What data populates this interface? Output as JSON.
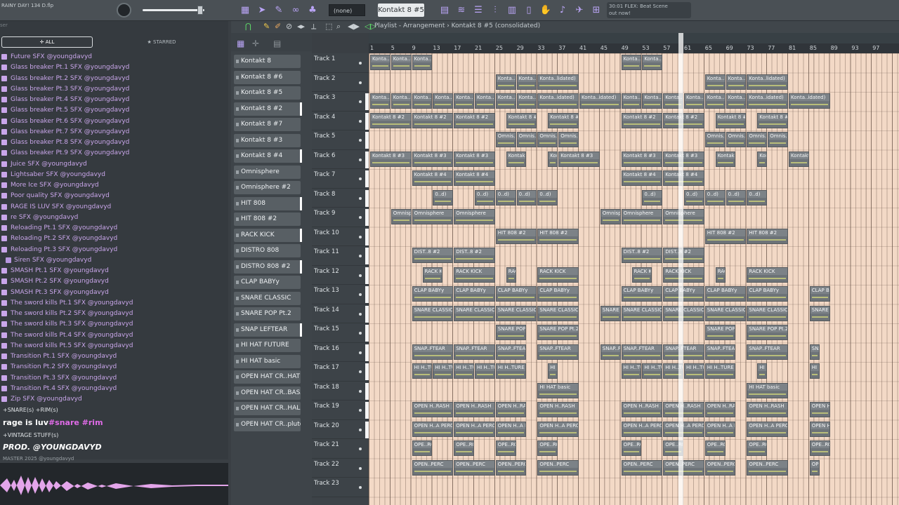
{
  "project_title": "RAINY DAY! 134 D.flp",
  "toolbar": {
    "pattern": "(none)",
    "channel": "Kontakt 8 #5",
    "news_line1": "30:01  FLEX: Beat Scene",
    "news_line2": "out now!"
  },
  "browser": {
    "search_placeholder": "ser",
    "tab_all": "ALL",
    "tab_starred": "STARRED",
    "items": [
      {
        "label": "Future SFX @youngdavyd",
        "folder": false
      },
      {
        "label": "Glass breaker Pt.1 SFX @youngdavyd",
        "folder": false
      },
      {
        "label": "Glass breaker Pt.2 SFX @youngdavyd",
        "folder": false
      },
      {
        "label": "Glass breaker Pt.3 SFX @youngdavyd",
        "folder": false
      },
      {
        "label": "Glass breaker Pt.4 SFX @youngdavyd",
        "folder": false
      },
      {
        "label": "Glass breaker Pt.5 SFX @youngdavyd",
        "folder": false
      },
      {
        "label": "Glass breaker Pt.6 SFX @youngdavyd",
        "folder": false
      },
      {
        "label": "Glass breaker Pt.7 SFX @youngdavyd",
        "folder": false
      },
      {
        "label": "Glass breaker Pt.8 SFX @youngdavyd",
        "folder": false
      },
      {
        "label": "Glass breaker Pt.9 SFX @youngdavyd",
        "folder": false
      },
      {
        "label": "Juice SFX @youngdavyd",
        "folder": false
      },
      {
        "label": "Lightsaber SFX @youngdavyd",
        "folder": false
      },
      {
        "label": "More Ice SFX @youngdavyd",
        "folder": false
      },
      {
        "label": "Poor quality SFX @youngdavyd",
        "folder": false
      },
      {
        "label": "RAGE IS LUV SFX @youngdavyd",
        "folder": false
      },
      {
        "label": "re SFX @youngdavyd",
        "folder": false
      },
      {
        "label": "Reloading Pt.1 SFX @youngdavyd",
        "folder": false
      },
      {
        "label": "Reloading Pt.2 SFX @youngdavyd",
        "folder": false
      },
      {
        "label": "Reloading Pt.3 SFX @youngdavyd",
        "folder": false
      },
      {
        "label": "Siren SFX @youngdavyd",
        "folder": true
      },
      {
        "label": "SMASH Pt.1 SFX @youngdavyd",
        "folder": false
      },
      {
        "label": "SMASH Pt.2 SFX @youngdavyd",
        "folder": false
      },
      {
        "label": "SMASH Pt.3 SFX @youngdavyd",
        "folder": false
      },
      {
        "label": "The sword kills Pt.1 SFX @youngdavyd",
        "folder": false
      },
      {
        "label": "The sword kills Pt.2 SFX @youngdavyd",
        "folder": false
      },
      {
        "label": "The sword kills Pt.3 SFX @youngdavyd",
        "folder": false
      },
      {
        "label": "The sword kills Pt.4 SFX @youngdavyd",
        "folder": false
      },
      {
        "label": "The sword kills Pt.5 SFX @youngdavyd",
        "folder": false
      },
      {
        "label": "Transition Pt.1 SFX @youngdavyd",
        "folder": false
      },
      {
        "label": "Transition Pt.2 SFX @youngdavyd",
        "folder": false
      },
      {
        "label": "Transition Pt.3 SFX @youngdavyd",
        "folder": false
      },
      {
        "label": "Transition Pt.4 SFX @youngdavyd",
        "folder": false
      },
      {
        "label": "Zip SFX @youngdavyd",
        "folder": false
      }
    ],
    "preview": {
      "line1": "+SNARE(s) +RIM(s)",
      "line2_a": "rage is luv",
      "line2_b": "#snare #rim",
      "line3": "+VINTAGE STUFF(s)",
      "line4": "PROD. @YOUNGDAVYD",
      "line5": "MASTER 2025 @youngdavyd"
    }
  },
  "channels": [
    "Kontakt 8",
    "Kontakt 8 #6",
    "Kontakt 8 #5",
    "Kontakt 8 #2",
    "Kontakt 8 #7",
    "Kontakt 8 #3",
    "Kontakt 8 #4",
    "Omnisphere",
    "Omnisphere #2",
    "HIT 808",
    "HIT 808 #2",
    "RACK KICK",
    "DISTRO 808",
    "DISTRO 808 #2",
    "CLAP BABYy",
    "SNARE CLASSIC",
    "SNARE POP Pt.2",
    "SNAP LEFTEAR",
    "HI HAT FUTURE",
    "HI HAT basic",
    "OPEN HAT CR..HAT CRASH",
    "OPEN HAT CR..BASA PERC",
    "OPEN HAT CR..HALL PERC",
    "OPEN HAT CR..pluto PERC"
  ],
  "playlist": {
    "title": "Playlist - Arrangement › Kontakt 8 #5 (consolidated)",
    "ruler": [
      "1",
      "5",
      "9",
      "13",
      "17",
      "21",
      "25",
      "29",
      "33",
      "37",
      "41",
      "45",
      "49",
      "53",
      "57",
      "61",
      "65",
      "69",
      "73",
      "77",
      "81",
      "85",
      "89",
      "93",
      "97"
    ],
    "tracks": [
      "Track 1",
      "Track 2",
      "Track 3",
      "Track 4",
      "Track 5",
      "Track 6",
      "Track 7",
      "Track 8",
      "Track 9",
      "Track 10",
      "Track 11",
      "Track 12",
      "Track 13",
      "Track 14",
      "Track 15",
      "Track 16",
      "Track 17",
      "Track 18",
      "Track 19",
      "Track 20",
      "Track 21",
      "Track 22",
      "Track 23"
    ],
    "clips": [
      {
        "track": 0,
        "bars": [
          [
            1,
            5
          ],
          [
            5,
            9
          ],
          [
            9,
            13
          ],
          [
            49,
            53
          ],
          [
            53,
            57
          ]
        ],
        "label": "Konta..idated)"
      },
      {
        "track": 1,
        "bars": [
          [
            25,
            29
          ],
          [
            29,
            33
          ],
          [
            33,
            41
          ],
          [
            65,
            69
          ],
          [
            69,
            73
          ],
          [
            73,
            81
          ]
        ],
        "label": "Konta..lidated)"
      },
      {
        "track": 2,
        "bars": [
          [
            1,
            5
          ],
          [
            5,
            9
          ],
          [
            9,
            13
          ],
          [
            13,
            17
          ],
          [
            17,
            21
          ],
          [
            21,
            25
          ],
          [
            25,
            29
          ],
          [
            29,
            33
          ],
          [
            33,
            41
          ],
          [
            41,
            49
          ],
          [
            49,
            53
          ],
          [
            53,
            57
          ],
          [
            57,
            61
          ],
          [
            61,
            65
          ],
          [
            65,
            69
          ],
          [
            69,
            73
          ],
          [
            73,
            81
          ],
          [
            81,
            89
          ]
        ],
        "label": "Konta..idated)"
      },
      {
        "track": 3,
        "bars": [
          [
            1,
            9
          ],
          [
            9,
            17
          ],
          [
            17,
            25
          ],
          [
            27,
            33
          ],
          [
            35,
            41
          ],
          [
            49,
            57
          ],
          [
            57,
            65
          ],
          [
            67,
            73
          ],
          [
            75,
            81
          ]
        ],
        "label": "Kontakt 8 #2"
      },
      {
        "track": 4,
        "bars": [
          [
            25,
            29
          ],
          [
            29,
            33
          ],
          [
            33,
            37
          ],
          [
            37,
            41
          ],
          [
            65,
            69
          ],
          [
            69,
            73
          ],
          [
            73,
            77
          ],
          [
            77,
            81
          ]
        ],
        "label": "Omnis..idated)"
      },
      {
        "track": 5,
        "bars": [
          [
            1,
            9
          ],
          [
            9,
            17
          ],
          [
            17,
            25
          ],
          [
            27,
            31
          ],
          [
            35,
            37
          ],
          [
            37,
            45
          ],
          [
            49,
            57
          ],
          [
            57,
            65
          ],
          [
            67,
            71
          ],
          [
            75,
            77
          ],
          [
            81,
            85
          ]
        ],
        "label": "Kontakt 8 #3"
      },
      {
        "track": 6,
        "bars": [
          [
            9,
            17
          ],
          [
            17,
            25
          ],
          [
            49,
            57
          ],
          [
            57,
            65
          ]
        ],
        "label": "Kontakt 8 #4"
      },
      {
        "track": 7,
        "bars": [
          [
            13,
            17
          ],
          [
            21,
            25
          ],
          [
            25,
            29
          ],
          [
            29,
            33
          ],
          [
            33,
            37
          ],
          [
            53,
            57
          ],
          [
            61,
            65
          ],
          [
            65,
            69
          ],
          [
            69,
            73
          ],
          [
            73,
            77
          ]
        ],
        "label": "0..d)"
      },
      {
        "track": 8,
        "bars": [
          [
            5,
            9
          ],
          [
            9,
            17
          ],
          [
            17,
            25
          ],
          [
            45,
            49
          ],
          [
            49,
            57
          ],
          [
            57,
            65
          ]
        ],
        "label": "Omnisphere"
      },
      {
        "track": 9,
        "bars": [
          [
            25,
            33
          ],
          [
            33,
            41
          ],
          [
            65,
            73
          ],
          [
            73,
            81
          ]
        ],
        "label": "HIT 808 #2"
      },
      {
        "track": 10,
        "bars": [
          [
            9,
            17
          ],
          [
            17,
            25
          ],
          [
            49,
            57
          ],
          [
            57,
            65
          ]
        ],
        "label": "DIST..8 #2"
      },
      {
        "track": 11,
        "bars": [
          [
            11,
            15
          ],
          [
            17,
            25
          ],
          [
            27,
            29
          ],
          [
            33,
            41
          ],
          [
            51,
            55
          ],
          [
            57,
            65
          ],
          [
            67,
            69
          ],
          [
            73,
            81
          ]
        ],
        "label": "RACK KICK"
      },
      {
        "track": 12,
        "bars": [
          [
            9,
            17
          ],
          [
            17,
            25
          ],
          [
            25,
            33
          ],
          [
            33,
            41
          ],
          [
            49,
            57
          ],
          [
            57,
            65
          ],
          [
            65,
            73
          ],
          [
            73,
            81
          ],
          [
            85,
            89
          ]
        ],
        "label": "CLAP BABYy"
      },
      {
        "track": 13,
        "bars": [
          [
            9,
            17
          ],
          [
            17,
            25
          ],
          [
            25,
            33
          ],
          [
            33,
            41
          ],
          [
            45,
            49
          ],
          [
            49,
            57
          ],
          [
            57,
            65
          ],
          [
            65,
            73
          ],
          [
            73,
            81
          ],
          [
            85,
            89
          ]
        ],
        "label": "SNARE CLASSIC"
      },
      {
        "track": 14,
        "bars": [
          [
            25,
            31
          ],
          [
            33,
            41
          ],
          [
            65,
            71
          ],
          [
            73,
            81
          ]
        ],
        "label": "SNARE POP Pt.2"
      },
      {
        "track": 15,
        "bars": [
          [
            9,
            17
          ],
          [
            17,
            25
          ],
          [
            25,
            31
          ],
          [
            33,
            41
          ],
          [
            45,
            49
          ],
          [
            49,
            57
          ],
          [
            57,
            65
          ],
          [
            65,
            71
          ],
          [
            73,
            81
          ],
          [
            85,
            87
          ]
        ],
        "label": "SNAP..FTEAR"
      },
      {
        "track": 16,
        "bars": [
          [
            9,
            13
          ],
          [
            13,
            17
          ],
          [
            17,
            21
          ],
          [
            21,
            25
          ],
          [
            25,
            31
          ],
          [
            35,
            37
          ],
          [
            49,
            53
          ],
          [
            53,
            57
          ],
          [
            57,
            61
          ],
          [
            61,
            65
          ],
          [
            65,
            71
          ],
          [
            75,
            77
          ],
          [
            85,
            87
          ]
        ],
        "label": "HI H..TURE"
      },
      {
        "track": 17,
        "bars": [
          [
            33,
            41
          ],
          [
            73,
            81
          ]
        ],
        "label": "HI HAT basic"
      },
      {
        "track": 18,
        "bars": [
          [
            9,
            17
          ],
          [
            17,
            25
          ],
          [
            25,
            31
          ],
          [
            33,
            41
          ],
          [
            49,
            57
          ],
          [
            57,
            65
          ],
          [
            65,
            71
          ],
          [
            73,
            81
          ],
          [
            85,
            89
          ]
        ],
        "label": "OPEN H..RASH"
      },
      {
        "track": 19,
        "bars": [
          [
            9,
            17
          ],
          [
            17,
            25
          ],
          [
            25,
            31
          ],
          [
            33,
            41
          ],
          [
            49,
            57
          ],
          [
            57,
            65
          ],
          [
            65,
            71
          ],
          [
            73,
            81
          ],
          [
            85,
            89
          ]
        ],
        "label": "OPEN H..A PERC"
      },
      {
        "track": 20,
        "bars": [
          [
            9,
            13
          ],
          [
            17,
            21
          ],
          [
            25,
            29
          ],
          [
            33,
            37
          ],
          [
            49,
            53
          ],
          [
            57,
            61
          ],
          [
            65,
            69
          ],
          [
            73,
            77
          ],
          [
            85,
            89
          ]
        ],
        "label": "OPE..RC"
      },
      {
        "track": 21,
        "bars": [
          [
            9,
            17
          ],
          [
            17,
            25
          ],
          [
            25,
            31
          ],
          [
            33,
            41
          ],
          [
            49,
            57
          ],
          [
            57,
            65
          ],
          [
            65,
            71
          ],
          [
            73,
            81
          ],
          [
            85,
            87
          ]
        ],
        "label": "OPEN..PERC"
      }
    ]
  }
}
